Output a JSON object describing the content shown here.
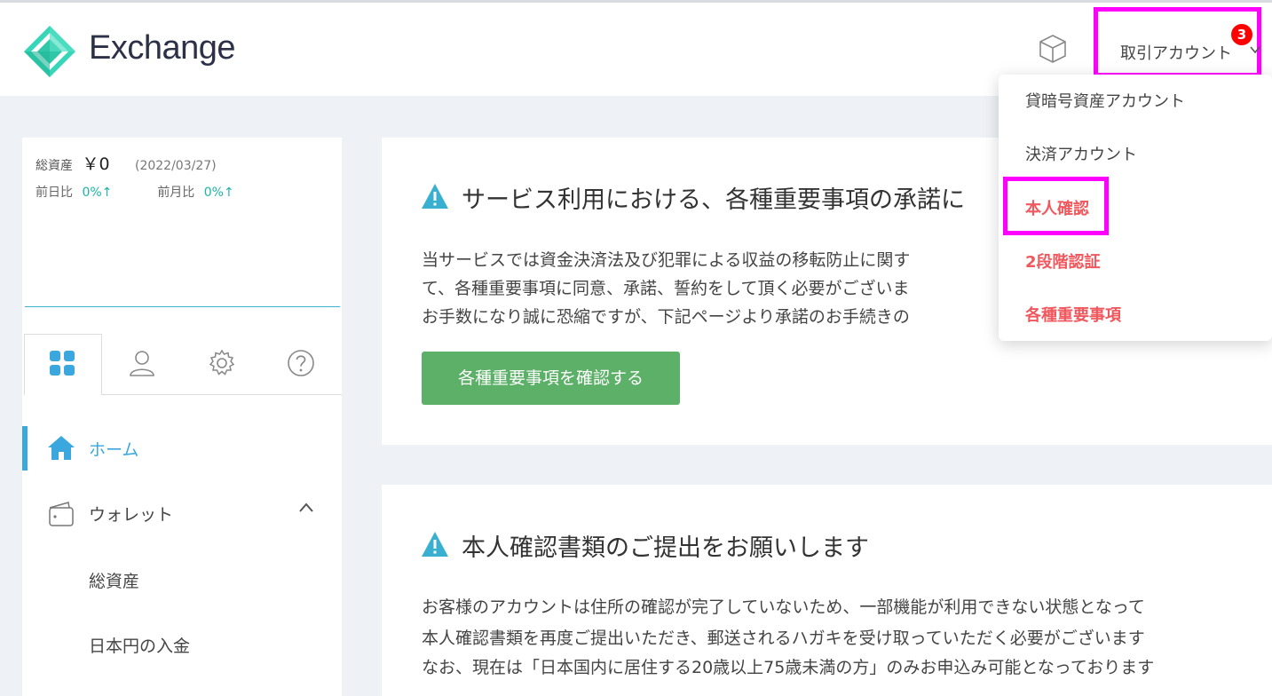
{
  "header": {
    "brand": "Exchange",
    "account_label": "取引アカウント",
    "badge_count": "3"
  },
  "sidebar": {
    "total_assets_label": "総資産",
    "total_assets_value": "￥0",
    "total_assets_date": "(2022/03/27)",
    "prev_day_label": "前日比",
    "prev_day_value": "0%↑",
    "prev_month_label": "前月比",
    "prev_month_value": "0%↑",
    "nav": {
      "home": "ホーム",
      "wallet": "ウォレット",
      "total_assets": "総資産",
      "jpy_deposit": "日本円の入金"
    }
  },
  "main": {
    "card1": {
      "title": "サービス利用における、各種重要事項の承諾に",
      "lines": [
        "当サービスでは資金決済法及び犯罪による収益の移転防止に関す",
        "て、各種重要事項に同意、承諾、誓約をして頂く必要がございま",
        "お手数になり誠に恐縮ですが、下記ページより承諾のお手続きの"
      ],
      "button": "各種重要事項を確認する"
    },
    "card2": {
      "title": "本人確認書類のご提出をお願いします",
      "lines": [
        "お客様のアカウントは住所の確認が完了していないため、一部機能が利用できない状態となって",
        "本人確認書類を再度ご提出いただき、郵送されるハガキを受け取っていただく必要がございます",
        "なお、現在は「日本国内に居住する20歳以上75歳未満の方」のみお申込み可能となっております"
      ]
    }
  },
  "dropdown": {
    "items": [
      "貸暗号資産アカウント",
      "決済アカウント",
      "本人確認",
      "2段階認証",
      "各種重要事項"
    ]
  },
  "colors": {
    "accent": "#3aa8df",
    "teal": "#1bb5a5",
    "button_green": "#5cb068",
    "alert_red": "#f0585e",
    "highlight": "#ff00ff"
  }
}
